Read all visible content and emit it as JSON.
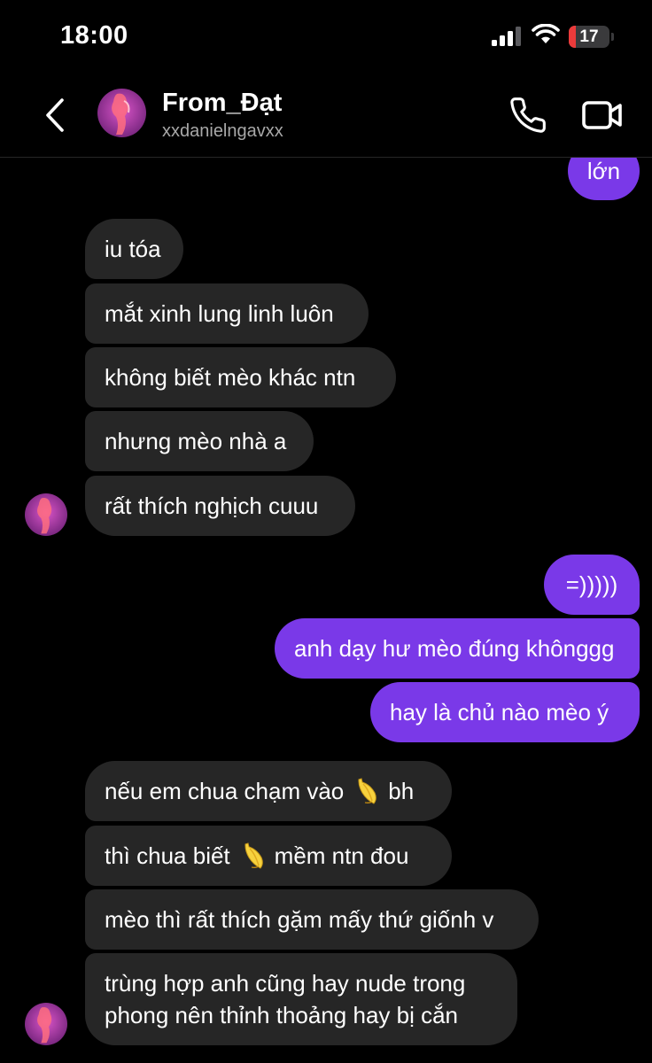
{
  "status_bar": {
    "time": "18:00",
    "battery": "17",
    "battery_level": 0.17
  },
  "header": {
    "name": "From_Đạt",
    "handle": "xxdanielngavxx"
  },
  "messages": [
    {
      "from": "me",
      "text": "lớn"
    },
    {
      "from": "them",
      "text": "iu tóa"
    },
    {
      "from": "them",
      "text": "mắt xinh lung linh luôn"
    },
    {
      "from": "them",
      "text": "không biết mèo khác ntn"
    },
    {
      "from": "them",
      "text": "nhưng mèo nhà a"
    },
    {
      "from": "them",
      "text": "rất thích nghịch cuuu"
    },
    {
      "from": "me",
      "text": "=)))))"
    },
    {
      "from": "me",
      "text": "anh dạy hư mèo đúng khônggg"
    },
    {
      "from": "me",
      "text": "hay là chủ nào mèo ý"
    },
    {
      "from": "them",
      "before": "nếu em chua chạm vào",
      "emoji": "banana",
      "after": "bh"
    },
    {
      "from": "them",
      "before": "thì chua biết",
      "emoji": "banana",
      "after": "mềm ntn đou"
    },
    {
      "from": "them",
      "text": "mèo thì rất thích gặm mấy thứ giốnh v"
    },
    {
      "from": "them",
      "line1": "trùng hợp anh cũng hay nude trong",
      "line2": "phong nên thỉnh thoảng hay bị cắn"
    }
  ]
}
